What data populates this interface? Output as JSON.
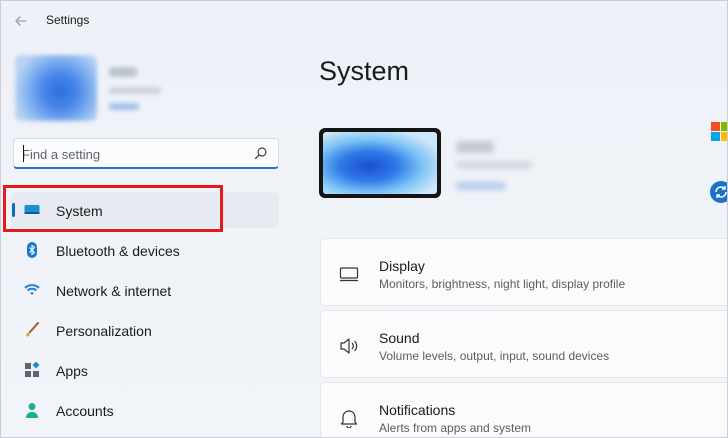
{
  "window": {
    "title": "Settings"
  },
  "search": {
    "placeholder": "Find a setting"
  },
  "sidebar": {
    "items": [
      {
        "label": "System",
        "icon": "monitor-icon",
        "selected": true
      },
      {
        "label": "Bluetooth & devices",
        "icon": "bluetooth-icon"
      },
      {
        "label": "Network & internet",
        "icon": "wifi-icon"
      },
      {
        "label": "Personalization",
        "icon": "brush-icon"
      },
      {
        "label": "Apps",
        "icon": "apps-icon"
      },
      {
        "label": "Accounts",
        "icon": "person-icon"
      }
    ]
  },
  "main": {
    "title": "System",
    "cards": [
      {
        "title": "Display",
        "subtitle": "Monitors, brightness, night light, display profile",
        "icon": "display-icon"
      },
      {
        "title": "Sound",
        "subtitle": "Volume levels, output, input, sound devices",
        "icon": "speaker-icon"
      },
      {
        "title": "Notifications",
        "subtitle": "Alerts from apps and system",
        "icon": "bell-icon"
      }
    ]
  },
  "colors": {
    "accent": "#0f6cbd",
    "highlight": "#e41b1b",
    "background": "#eef2f7"
  }
}
